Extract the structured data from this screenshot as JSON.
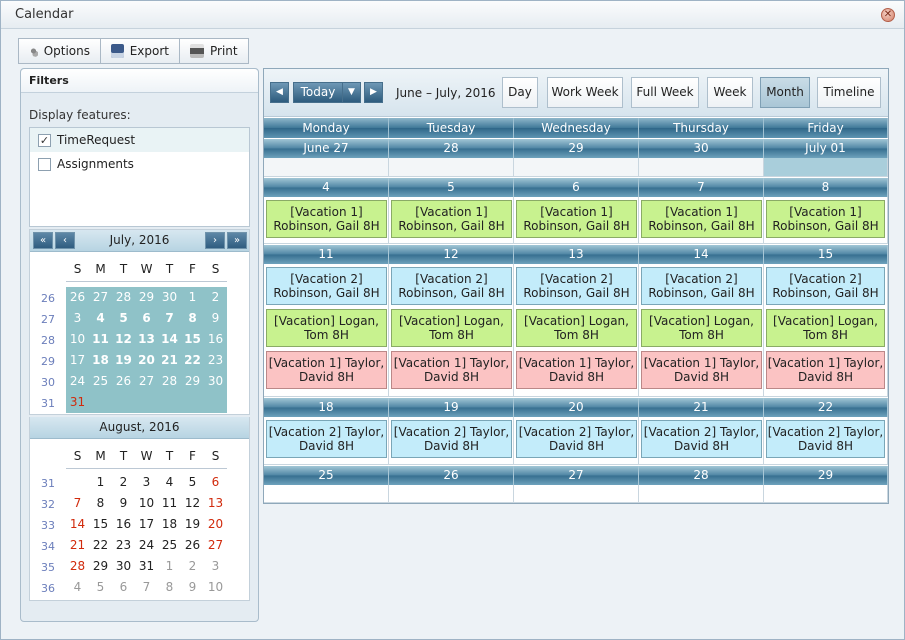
{
  "window": {
    "title": "Calendar"
  },
  "toolbar": {
    "options": "Options",
    "export": "Export",
    "print": "Print"
  },
  "filters": {
    "title": "Filters",
    "display_label": "Display features:",
    "features": [
      {
        "label": "TimeRequest",
        "checked": true
      },
      {
        "label": "Assignments",
        "checked": false
      }
    ]
  },
  "minical1": {
    "title": "July, 2016",
    "nav": {
      "prev2": "«",
      "prev": "‹",
      "next": "›",
      "next2": "»"
    },
    "dow": [
      "S",
      "M",
      "T",
      "W",
      "T",
      "F",
      "S"
    ],
    "weeks": [
      {
        "wk": "26",
        "days": [
          "26",
          "27",
          "28",
          "29",
          "30",
          "1",
          "2"
        ]
      },
      {
        "wk": "27",
        "days": [
          "3",
          "4",
          "5",
          "6",
          "7",
          "8",
          "9"
        ]
      },
      {
        "wk": "28",
        "days": [
          "10",
          "11",
          "12",
          "13",
          "14",
          "15",
          "16"
        ]
      },
      {
        "wk": "29",
        "days": [
          "17",
          "18",
          "19",
          "20",
          "21",
          "22",
          "23"
        ]
      },
      {
        "wk": "30",
        "days": [
          "24",
          "25",
          "26",
          "27",
          "28",
          "29",
          "30"
        ]
      },
      {
        "wk": "31",
        "days": [
          "31"
        ]
      }
    ]
  },
  "minical2": {
    "title": "August, 2016",
    "dow": [
      "S",
      "M",
      "T",
      "W",
      "T",
      "F",
      "S"
    ],
    "weeks": [
      {
        "wk": "31",
        "days": [
          "",
          "1",
          "2",
          "3",
          "4",
          "5",
          "6"
        ]
      },
      {
        "wk": "32",
        "days": [
          "7",
          "8",
          "9",
          "10",
          "11",
          "12",
          "13"
        ]
      },
      {
        "wk": "33",
        "days": [
          "14",
          "15",
          "16",
          "17",
          "18",
          "19",
          "20"
        ]
      },
      {
        "wk": "34",
        "days": [
          "21",
          "22",
          "23",
          "24",
          "25",
          "26",
          "27"
        ]
      },
      {
        "wk": "35",
        "days": [
          "28",
          "29",
          "30",
          "31",
          "1",
          "2",
          "3"
        ]
      },
      {
        "wk": "36",
        "days": [
          "4",
          "5",
          "6",
          "7",
          "8",
          "9",
          "10"
        ]
      }
    ]
  },
  "scheduler": {
    "today": "Today",
    "range": "June – July, 2016",
    "views": [
      "Day",
      "Work Week",
      "Full Week",
      "Week",
      "Month",
      "Timeline"
    ],
    "active_view": "Month",
    "days": [
      "Monday",
      "Tuesday",
      "Wednesday",
      "Thursday",
      "Friday"
    ],
    "weeks": [
      {
        "dates": [
          "June 27",
          "28",
          "29",
          "30",
          "July 01"
        ]
      },
      {
        "dates": [
          "4",
          "5",
          "6",
          "7",
          "8"
        ],
        "events": [
          [
            "[Vacation 1]",
            "Robinson, Gail 8H",
            "g"
          ]
        ]
      },
      {
        "dates": [
          "11",
          "12",
          "13",
          "14",
          "15"
        ],
        "events": [
          [
            "[Vacation 2]",
            "Robinson, Gail 8H",
            "b"
          ],
          [
            "[Vacation] Logan,",
            "Tom 8H",
            "g"
          ],
          [
            "[Vacation 1] Taylor,",
            "David 8H",
            "r"
          ]
        ]
      },
      {
        "dates": [
          "18",
          "19",
          "20",
          "21",
          "22"
        ],
        "events": [
          [
            "[Vacation 2] Taylor,",
            "David 8H",
            "b"
          ]
        ]
      },
      {
        "dates": [
          "25",
          "26",
          "27",
          "28",
          "29"
        ]
      }
    ]
  },
  "colors": {
    "event_green": "#c8f28f",
    "event_blue": "#c3ecfa",
    "event_red": "#fbc3c3",
    "header": "#3f7898",
    "highlight": "#8fc2c8"
  }
}
